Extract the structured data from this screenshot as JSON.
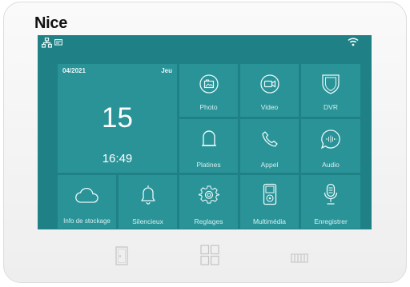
{
  "brand": "Nice",
  "status": {
    "network_icon": "network-icon",
    "message_icon": "message-icon",
    "wifi_icon": "wifi-icon"
  },
  "date_tile": {
    "date": "04/2021",
    "weekday": "Jeu",
    "day": "15",
    "time": "16:49"
  },
  "tiles": {
    "photo": "Photo",
    "video": "Video",
    "dvr": "DVR",
    "platines": "Platines",
    "appel": "Appel",
    "audio": "Audio",
    "storage": "Info de stockage",
    "silencieux": "Silencieux",
    "reglages": "Reglages",
    "multimedia": "Multimédia",
    "enregistrer": "Enregistrer"
  },
  "hardware_buttons": {
    "door_icon": "door-icon",
    "menu_icon": "grid-icon",
    "intercom_icon": "gate-icon"
  },
  "colors": {
    "screen_bg": "#1f8185",
    "tile_bg": "#2a9398"
  }
}
